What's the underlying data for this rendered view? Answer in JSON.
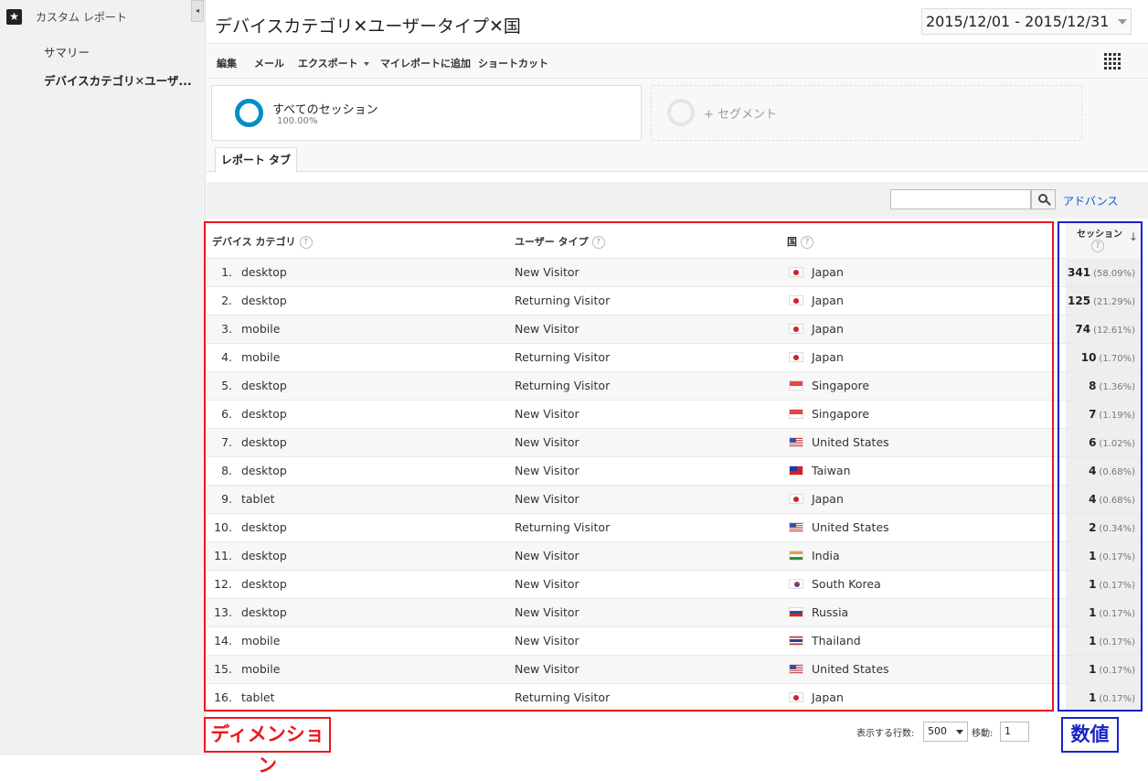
{
  "sidebar": {
    "header": "カスタム レポート",
    "collapse_icon": "◂",
    "items": [
      {
        "label": "サマリー"
      },
      {
        "label": "デバイスカテゴリ✕ユーザ..."
      }
    ]
  },
  "header": {
    "title": "デバイスカテゴリ✕ユーザータイプ✕国",
    "date_range": "2015/12/01 - 2015/12/31"
  },
  "toolbar": {
    "edit": "編集",
    "mail": "メール",
    "export": "エクスポート",
    "add_to_myreport": "マイレポートに追加",
    "shortcut": "ショートカット"
  },
  "segments": {
    "all_sessions": "すべてのセッション",
    "all_sessions_pct": "100.00%",
    "add_segment": "+ セグメント"
  },
  "tabs": [
    {
      "label": "レポート タブ"
    }
  ],
  "search": {
    "advanced_label": "アドバンス"
  },
  "table": {
    "columns": {
      "device": "デバイス カテゴリ",
      "user_type": "ユーザー タイプ",
      "country": "国",
      "sessions": "セッション"
    },
    "help_glyph": "?",
    "sort_glyph": "↓",
    "rows": [
      {
        "num": "1.",
        "device": "desktop",
        "user_type": "New Visitor",
        "flag": "jp",
        "country": "Japan",
        "value": "341",
        "pct": "(58.09%)"
      },
      {
        "num": "2.",
        "device": "desktop",
        "user_type": "Returning Visitor",
        "flag": "jp",
        "country": "Japan",
        "value": "125",
        "pct": "(21.29%)"
      },
      {
        "num": "3.",
        "device": "mobile",
        "user_type": "New Visitor",
        "flag": "jp",
        "country": "Japan",
        "value": "74",
        "pct": "(12.61%)"
      },
      {
        "num": "4.",
        "device": "mobile",
        "user_type": "Returning Visitor",
        "flag": "jp",
        "country": "Japan",
        "value": "10",
        "pct": "(1.70%)"
      },
      {
        "num": "5.",
        "device": "desktop",
        "user_type": "Returning Visitor",
        "flag": "sg",
        "country": "Singapore",
        "value": "8",
        "pct": "(1.36%)"
      },
      {
        "num": "6.",
        "device": "desktop",
        "user_type": "New Visitor",
        "flag": "sg",
        "country": "Singapore",
        "value": "7",
        "pct": "(1.19%)"
      },
      {
        "num": "7.",
        "device": "desktop",
        "user_type": "New Visitor",
        "flag": "us",
        "country": "United States",
        "value": "6",
        "pct": "(1.02%)"
      },
      {
        "num": "8.",
        "device": "desktop",
        "user_type": "New Visitor",
        "flag": "tw",
        "country": "Taiwan",
        "value": "4",
        "pct": "(0.68%)"
      },
      {
        "num": "9.",
        "device": "tablet",
        "user_type": "New Visitor",
        "flag": "jp",
        "country": "Japan",
        "value": "4",
        "pct": "(0.68%)"
      },
      {
        "num": "10.",
        "device": "desktop",
        "user_type": "Returning Visitor",
        "flag": "us",
        "country": "United States",
        "value": "2",
        "pct": "(0.34%)"
      },
      {
        "num": "11.",
        "device": "desktop",
        "user_type": "New Visitor",
        "flag": "in",
        "country": "India",
        "value": "1",
        "pct": "(0.17%)"
      },
      {
        "num": "12.",
        "device": "desktop",
        "user_type": "New Visitor",
        "flag": "kr",
        "country": "South Korea",
        "value": "1",
        "pct": "(0.17%)"
      },
      {
        "num": "13.",
        "device": "desktop",
        "user_type": "New Visitor",
        "flag": "ru",
        "country": "Russia",
        "value": "1",
        "pct": "(0.17%)"
      },
      {
        "num": "14.",
        "device": "mobile",
        "user_type": "New Visitor",
        "flag": "th",
        "country": "Thailand",
        "value": "1",
        "pct": "(0.17%)"
      },
      {
        "num": "15.",
        "device": "mobile",
        "user_type": "New Visitor",
        "flag": "us",
        "country": "United States",
        "value": "1",
        "pct": "(0.17%)"
      },
      {
        "num": "16.",
        "device": "tablet",
        "user_type": "Returning Visitor",
        "flag": "jp",
        "country": "Japan",
        "value": "1",
        "pct": "(0.17%)"
      }
    ]
  },
  "pagination": {
    "rows_label": "表示する行数:",
    "rows_value": "500",
    "goto_label": "移動:",
    "goto_value": "1"
  },
  "annotations": {
    "dimension": "ディメンション",
    "metric": "数値"
  },
  "colors": {
    "dimension_box": "#e8191e",
    "metric_box": "#1a23c8",
    "segment_ring": "#058dc7",
    "link": "#1155cc"
  }
}
